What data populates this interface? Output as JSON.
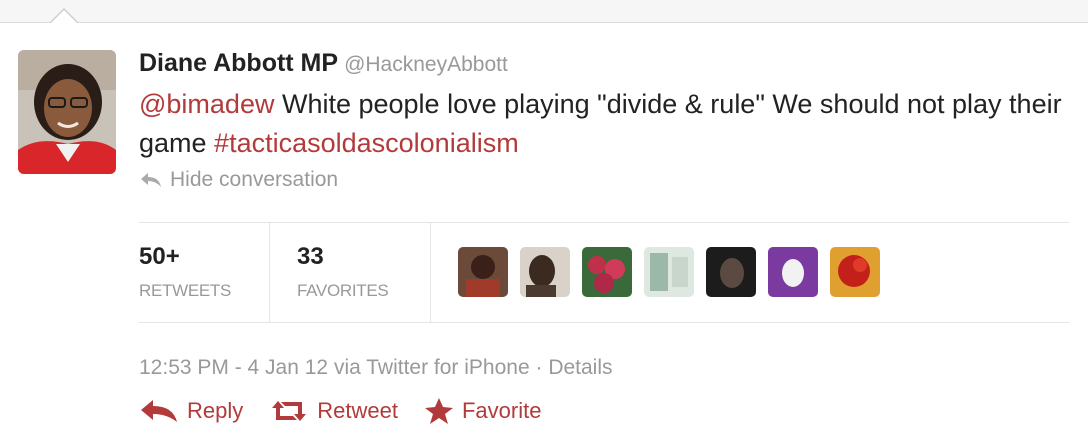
{
  "tweet": {
    "author_name": "Diane Abbott MP",
    "author_handle": "@HackneyAbbott",
    "mention": "@bimadew",
    "text_part1": " White people love playing \"divide & rule\" We should not play their game ",
    "hashtag": "#tacticasoldascolonialism",
    "hide_conversation": "Hide conversation",
    "retweets_count": "50+",
    "retweets_label": "RETWEETS",
    "favorites_count": "33",
    "favorites_label": "FAVORITES",
    "timestamp": "12:53 PM - 4 Jan 12 via Twitter for iPhone · Details",
    "reply_label": "Reply",
    "retweet_label": "Retweet",
    "favorite_label": "Favorite"
  },
  "colors": {
    "link": "#b33a3a",
    "muted": "#999999"
  },
  "icons": [
    "caret-up-icon",
    "reply-arrow-icon",
    "reply-icon",
    "retweet-icon",
    "star-icon"
  ]
}
